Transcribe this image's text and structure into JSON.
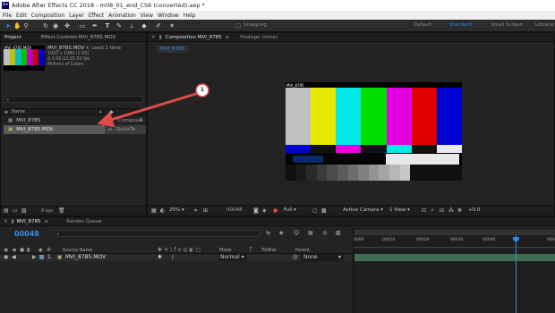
{
  "window": {
    "app_icon": "Ae",
    "title": "Adobe After Effects CC 2018 - m08_01_end_CS6 (converted).aep *"
  },
  "menu": [
    "File",
    "Edit",
    "Composition",
    "Layer",
    "Effect",
    "Animation",
    "View",
    "Window",
    "Help"
  ],
  "toolbar": {
    "icons": [
      "selection-arrow-icon",
      "hand-icon",
      "zoom-icon",
      "rotate-icon",
      "camera-orbit-icon",
      "pan-behind-icon",
      "rectangle-icon",
      "pen-icon",
      "type-icon",
      "brush-icon",
      "clone-stamp-icon",
      "eraser-icon",
      "roto-brush-icon",
      "puppet-pin-icon"
    ],
    "snapping": "Snapping",
    "workspaces": [
      "Default",
      "Standard",
      "Small Screen",
      "Librarie"
    ]
  },
  "project_panel": {
    "tabs": [
      "Project",
      "Effect Controls MVI_8785.MOV"
    ],
    "item_name": "MVI_8785.MOV",
    "used": ", used 1 time",
    "details": [
      "1920 x 1080 (1.00)",
      "Δ 0;00;12;25,00 fps",
      "Millions of Colors"
    ],
    "thumb_label": "MVI_8785.MOV",
    "columns": {
      "name": "Name",
      "type": "Type"
    },
    "items": [
      {
        "name": "MVI_8785",
        "type": "Composi"
      },
      {
        "name": "MVI_8785.MOV",
        "type": "QuickTe"
      }
    ],
    "bpc": "8 bpc"
  },
  "annotation": {
    "number": "1"
  },
  "comp_panel": {
    "tabs": [
      "Composition MVI_8785",
      "Footage (none)"
    ],
    "comp_tab": "MVI_8785",
    "frame_label": "MVI_8785",
    "zoom": "25%",
    "timecode": "00048",
    "resolution": "Full",
    "camera": "Active Camera",
    "views": "1 View",
    "exposure": "+0.0"
  },
  "timeline": {
    "tabs": [
      "MVI_8785",
      "Render Queue"
    ],
    "timecode": "00048",
    "search_placeholder": "⌕",
    "columns": {
      "source": "Source Name",
      "mode": "Mode",
      "trkmat": "TrkMat",
      "parent": "Parent"
    },
    "layer": {
      "num": "1",
      "name": "MVI_8785.MOV",
      "mode": "Normal",
      "parent": "None"
    },
    "ruler": [
      "0000",
      "00010",
      "00020",
      "00030",
      "00040",
      "0005"
    ],
    "playhead_fraction": 0.8
  },
  "colors": {
    "accent_blue": "#2d8ceb",
    "timecode_blue": "#3a8ee6",
    "annotation_red": "#e04a4a",
    "bars": [
      "#c0c0c0",
      "#c0c000",
      "#00c0c0",
      "#00c000",
      "#c000c0",
      "#c00000",
      "#0000c0"
    ]
  }
}
